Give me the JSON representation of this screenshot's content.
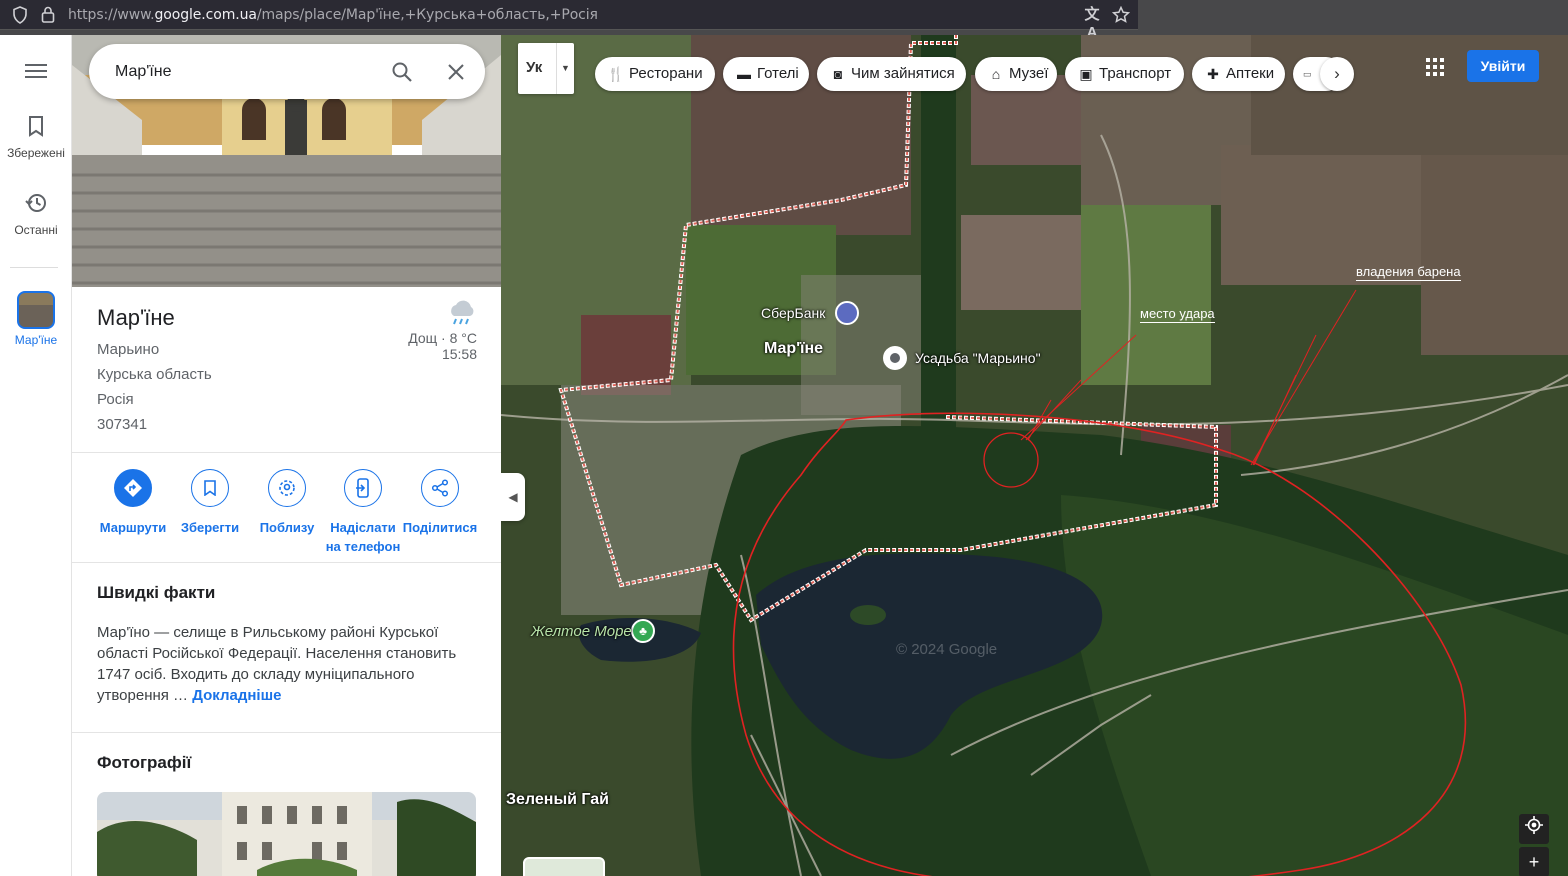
{
  "browser": {
    "url_prefix": "https://www.",
    "url_domain": "google.com.ua",
    "url_rest": "/maps/place/Мар'їне,+Курська+область,+Росія",
    "icons": [
      "shield-icon",
      "lock-icon",
      "translate-icon",
      "star-icon"
    ]
  },
  "rail": {
    "saved_label": "Збережені",
    "recent_label": "Останні",
    "place_label": "Мар'їне"
  },
  "search": {
    "query": "Мар'їне"
  },
  "place": {
    "name": "Мар'їне",
    "alt_name": "Марьино",
    "region": "Курська область",
    "country": "Росія",
    "postal_code": "307341",
    "weather_desc": "Дощ · 8 °C",
    "weather_time": "15:58"
  },
  "actions": [
    {
      "label": "Маршрути",
      "icon": "directions-icon"
    },
    {
      "label": "Зберегти",
      "icon": "bookmark-icon"
    },
    {
      "label": "Поблизу",
      "icon": "nearby-icon"
    },
    {
      "label": "Надіслати на телефон",
      "icon": "send-to-phone-icon"
    },
    {
      "label": "Поділитися",
      "icon": "share-icon"
    }
  ],
  "facts": {
    "heading": "Швидкі факти",
    "text": "Мар'їно — селище в Рильському районі Курської області Російської Федерації. Населення становить 1747 осіб. Входить до складу муніципального утворення … ",
    "more": "Докладніше"
  },
  "photos": {
    "heading": "Фотографії"
  },
  "map": {
    "language_code": "Ук",
    "chips": [
      {
        "label": "Ресторани",
        "icon": "fork-knife-icon"
      },
      {
        "label": "Готелі",
        "icon": "bed-icon"
      },
      {
        "label": "Чим зайнятися",
        "icon": "camera-icon"
      },
      {
        "label": "Музеї",
        "icon": "museum-icon"
      },
      {
        "label": "Транспорт",
        "icon": "bus-icon"
      },
      {
        "label": "Аптеки",
        "icon": "pharmacy-icon"
      }
    ],
    "signin": "Увійти",
    "labels": {
      "sberbank": "СберБанк",
      "town": "Мар'їне",
      "estate": "Усадьба \"Марьино\"",
      "lake": "Желтое Море",
      "village": "Зеленый Гай",
      "watermark": "© 2024 Google"
    },
    "annotations": {
      "strike": "место удара",
      "baron": "владения барена"
    }
  }
}
